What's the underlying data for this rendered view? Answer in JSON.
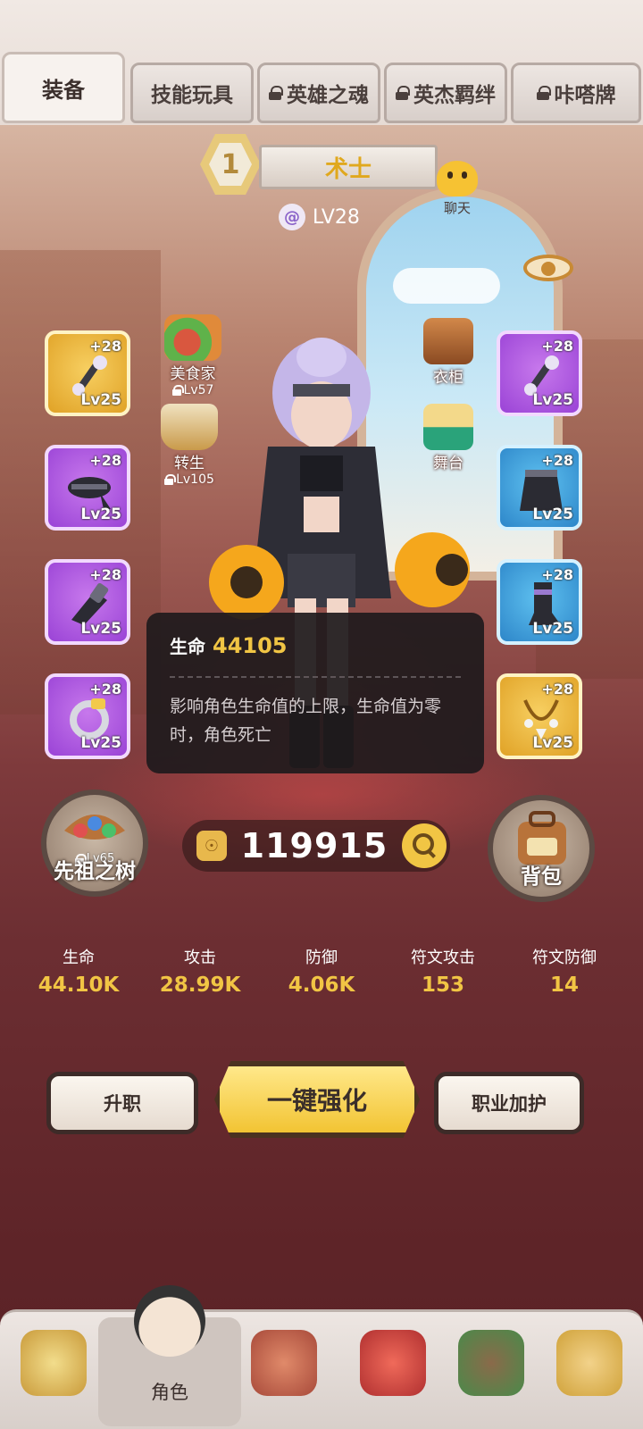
{
  "tabs": [
    {
      "label": "装备",
      "locked": false,
      "active": true
    },
    {
      "label": "技能玩具",
      "locked": false,
      "active": false
    },
    {
      "label": "英雄之魂",
      "locked": true,
      "active": false
    },
    {
      "label": "英杰羁绊",
      "locked": true,
      "active": false
    },
    {
      "label": "咔嗒牌",
      "locked": true,
      "active": false
    }
  ],
  "character": {
    "rank": "1",
    "class_name": "术士",
    "level": "LV28"
  },
  "chat_label": "聊天",
  "left_slots": [
    {
      "plus": "+28",
      "level": "Lv25",
      "rarity": "gold"
    },
    {
      "plus": "+28",
      "level": "Lv25",
      "rarity": "purple"
    },
    {
      "plus": "+28",
      "level": "Lv25",
      "rarity": "purple"
    },
    {
      "plus": "+28",
      "level": "Lv25",
      "rarity": "purple"
    }
  ],
  "right_slots": [
    {
      "plus": "+28",
      "level": "Lv25",
      "rarity": "purple"
    },
    {
      "plus": "+28",
      "level": "Lv25",
      "rarity": "blue"
    },
    {
      "plus": "+28",
      "level": "Lv25",
      "rarity": "blue"
    },
    {
      "plus": "+28",
      "level": "Lv25",
      "rarity": "gold"
    }
  ],
  "features_left": [
    {
      "name": "美食家",
      "req": "Lv57"
    },
    {
      "name": "转生",
      "req": "Lv105"
    }
  ],
  "features_right": [
    {
      "name": "衣柜"
    },
    {
      "name": "舞台"
    }
  ],
  "tooltip": {
    "title": "生命",
    "value": "44105",
    "description": "影响角色生命值的上限，生命值为零时，角色死亡"
  },
  "ancestor_tree": {
    "req": "Lv65",
    "label": "先祖之树"
  },
  "power": "119915",
  "backpack_label": "背包",
  "stats": [
    {
      "label": "生命",
      "value": "44.10K"
    },
    {
      "label": "攻击",
      "value": "28.99K"
    },
    {
      "label": "防御",
      "value": "4.06K"
    },
    {
      "label": "符文攻击",
      "value": "153"
    },
    {
      "label": "符文防御",
      "value": "14"
    }
  ],
  "actions": {
    "promote": "升职",
    "enhance": "一键强化",
    "class_bonus": "职业加护"
  },
  "bottom_nav": {
    "active_label": "角色"
  },
  "colors": {
    "gold_text": "#f1c544",
    "rarity_gold": "#e0a226",
    "rarity_purple": "#9a43d6",
    "rarity_blue": "#2d86c9"
  }
}
